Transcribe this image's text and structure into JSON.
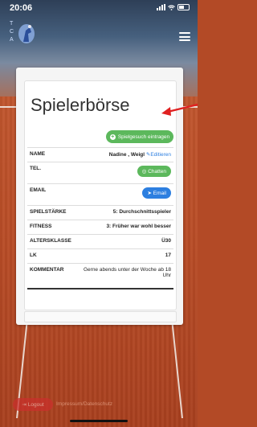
{
  "status_bar": {
    "time": "20:06"
  },
  "header": {
    "logo_letters": [
      "T",
      "C",
      "A"
    ]
  },
  "page": {
    "title": "Spielerbörse"
  },
  "actions": {
    "add_label": "Spielgesuch eintragen"
  },
  "profile": {
    "name_label": "NAME",
    "name_value": "Nadine , Weigl",
    "edit_label": "Editieren",
    "tel_label": "TEL.",
    "chat_label": "Chatten",
    "email_label": "EMAIL",
    "email_button": "Email",
    "staerke_label": "SPIELSTÄRKE",
    "staerke_value": "5: Durchschnittsspieler",
    "fitness_label": "FITNESS",
    "fitness_value": "3: Früher war wohl besser",
    "alters_label": "ALTERSKLASSE",
    "alters_value": "Ü30",
    "lk_label": "LK",
    "lk_value": "17",
    "kommentar_label": "KOMMENTAR",
    "kommentar_value": "Gerne abends unter der Woche ab 18 Uhr"
  },
  "footer": {
    "logout_label": "Logout",
    "links": "Impressum/Datenschutz"
  },
  "colors": {
    "success": "#5cb85c",
    "primary": "#2d7fe0",
    "danger": "#c9302c",
    "arrow": "#e02020"
  }
}
